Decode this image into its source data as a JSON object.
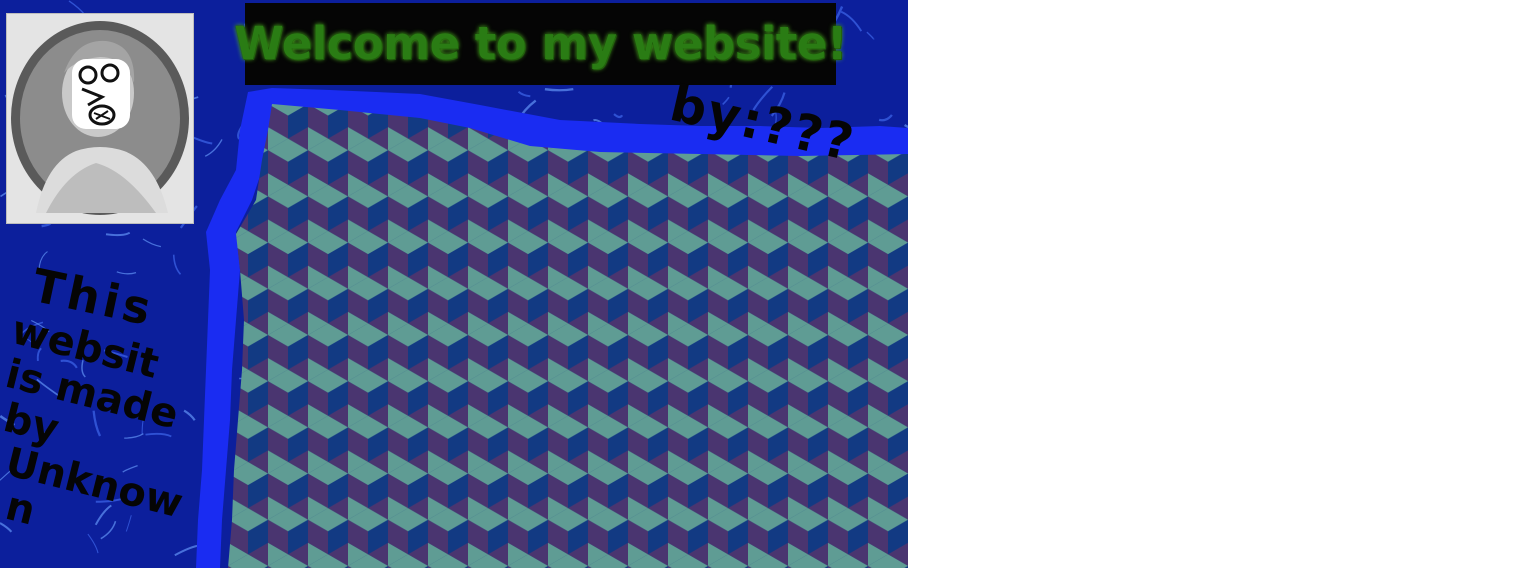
{
  "header": {
    "title": "Welcome to my website!",
    "byline": "by:???"
  },
  "sidebar": {
    "note_lines": [
      "This",
      "websit",
      "is made",
      "by",
      "Unknow",
      "n"
    ]
  },
  "portrait": {
    "icon": "defaced-bust-portrait"
  },
  "colors": {
    "background_blue": "#0c1f9c",
    "river_blue": "#1a2cf2",
    "banner_black": "#050505",
    "banner_text_green": "#2a7c14",
    "cube_light": "#5f9c94",
    "cube_dark": "#123a83",
    "cube_purple": "#4a3570"
  }
}
